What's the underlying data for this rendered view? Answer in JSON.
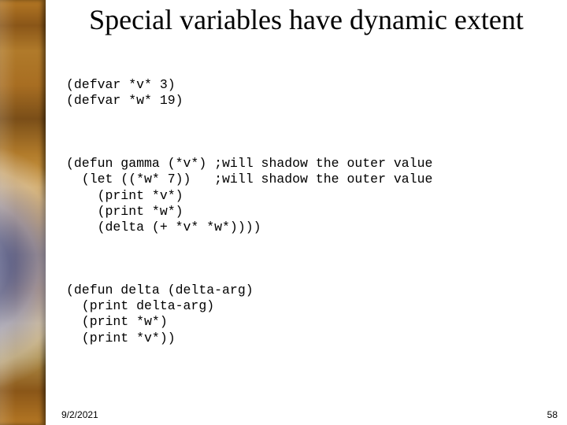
{
  "title": "Special variables have dynamic extent",
  "code": {
    "defvars": "(defvar *v* 3)\n(defvar *w* 19)",
    "gamma": "(defun gamma (*v*) ;will shadow the outer value\n  (let ((*w* 7))   ;will shadow the outer value\n    (print *v*)\n    (print *w*)\n    (delta (+ *v* *w*))))",
    "delta": "(defun delta (delta-arg)\n  (print delta-arg)\n  (print *w*)\n  (print *v*))"
  },
  "footer": {
    "date": "9/2/2021",
    "page": "58"
  }
}
